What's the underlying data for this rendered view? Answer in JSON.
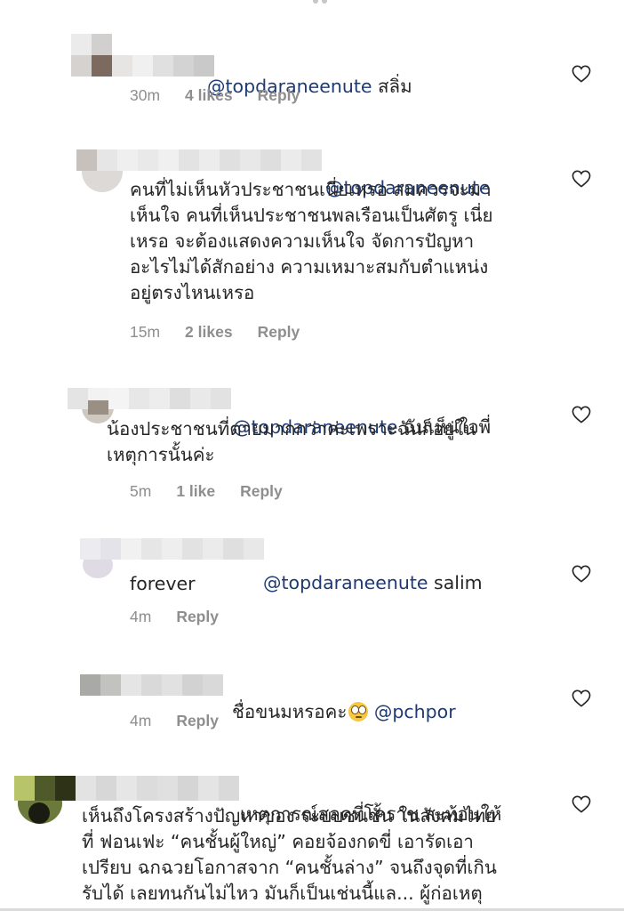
{
  "comments": [
    {
      "username_hidden": true,
      "mention": "@topdaraneenute",
      "text": "สลิ่ม",
      "time": "30m",
      "likes": "4 likes",
      "reply": "Reply"
    },
    {
      "username_hidden": true,
      "mention": "@topdaraneenute",
      "text": "คนที่ไม่เห็นหัวประชาชนเนี่ยเหรอ สมควรจะมา\nเห็นใจ คนที่เห็นประชาชนพลเรือนเป็นศัตรู เนี่ย\nเหรอ จะต้องแสดงความเห็นใจ จัดการปัญหา\nอะไรไม่ได้สักอย่าง ความเหมาะสมกับตำแหน่ง\nอยู่ตรงไหนเหรอ",
      "time": "15m",
      "likes": "2 likes",
      "reply": "Reply"
    },
    {
      "username_hidden": true,
      "mention": "@topdaraneenute",
      "text_line1": "ฉันเห็นใจพี่",
      "text": "น้องประชาชนที่ตายมากกว่าค่ะเพราะฉันก็อยู่ใน\nเหตุการนั้นค่ะ",
      "time": "5m",
      "likes": "1 like",
      "reply": "Reply"
    },
    {
      "username_hidden": true,
      "mention": "@topdaraneenute",
      "text_line1": "salim",
      "text": "forever",
      "time": "4m",
      "reply": "Reply"
    },
    {
      "username_hidden": true,
      "text": "ชื่อขนมหรอคะ",
      "emoji": "face-with-rolling-eyes",
      "mention": "@pchpor",
      "time": "4m",
      "reply": "Reply"
    },
    {
      "username_hidden": true,
      "text_line1": "เหตุการณ์สลดที่โคราช สะท้อนให้",
      "text": "เห็นถึงโครงสร้างปัญหาของ ระบบชนชั้น ในสังคมไทย\nที่ ฟอนเฟะ “คนชั้นผู้ใหญ่” คอยจ้องกดขี่ เอารัดเอา\nเปรียบ ฉกฉวยโอกาสจาก “คนชั้นล่าง”  จนถึงจุดที่เกิน\nรับได้ เลยทนกันไม่ไหว มันก็เป็นเช่นนี้แล... ผู้ก่อเหตุ"
    }
  ],
  "icons": {
    "like": "heart-outline-icon"
  },
  "colors": {
    "mention": "#1e3a73",
    "meta": "#8e8e8e",
    "text": "#262626"
  }
}
